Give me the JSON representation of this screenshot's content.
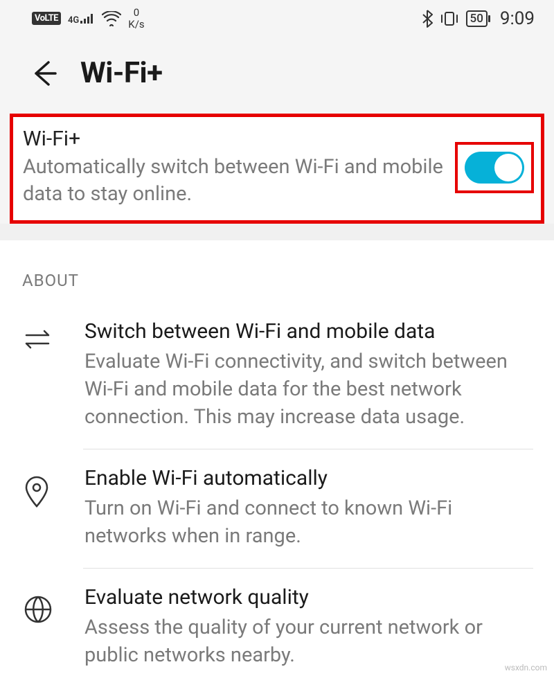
{
  "status": {
    "volte": "VoLTE",
    "net_gen": "4G",
    "speed_num": "0",
    "speed_unit": "K/s",
    "battery": "50",
    "time": "9:09"
  },
  "header": {
    "title": "Wi-Fi+"
  },
  "main_toggle": {
    "title": "Wi-Fi+",
    "desc": "Automatically switch between Wi-Fi and mobile data to stay online.",
    "enabled": true
  },
  "about": {
    "label": "ABOUT",
    "items": [
      {
        "icon": "arrows-icon",
        "title": "Switch between Wi-Fi and mobile data",
        "desc": "Evaluate Wi-Fi connectivity, and switch between Wi-Fi and mobile data for the best network connection. This may increase data usage."
      },
      {
        "icon": "location-icon",
        "title": "Enable Wi-Fi automatically",
        "desc": "Turn on Wi-Fi and connect to known Wi-Fi networks when in range."
      },
      {
        "icon": "globe-icon",
        "title": "Evaluate network quality",
        "desc": "Assess the quality of your current network or public networks nearby."
      }
    ]
  },
  "watermark": "wsxdn.com"
}
